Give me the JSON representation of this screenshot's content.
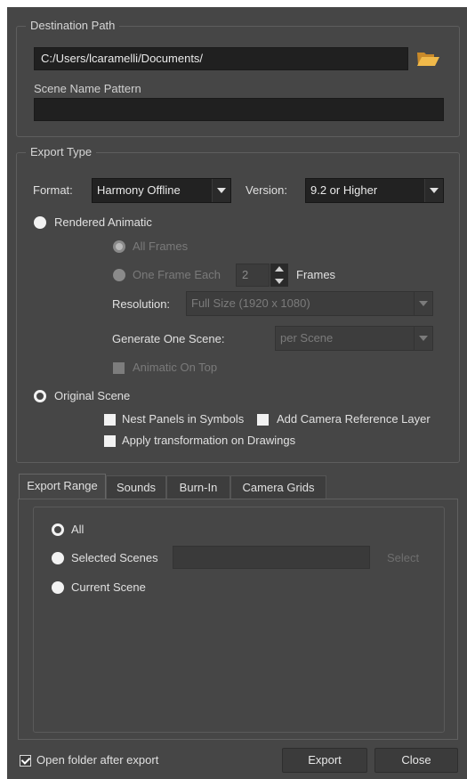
{
  "destination": {
    "legend": "Destination Path",
    "path_value": "C:/Users/lcaramelli/Documents/",
    "folder_icon": "folder-open-icon",
    "scene_pattern_label": "Scene Name Pattern",
    "scene_pattern_value": ""
  },
  "export_type": {
    "legend": "Export Type",
    "format_label": "Format:",
    "format_value": "Harmony Offline",
    "version_label": "Version:",
    "version_value": "9.2 or Higher",
    "rendered_animatic_label": "Rendered Animatic",
    "all_frames_label": "All Frames",
    "one_frame_each_label": "One Frame Each",
    "one_frame_each_value": "2",
    "frames_label": "Frames",
    "resolution_label": "Resolution:",
    "resolution_value": "Full Size (1920 x 1080)",
    "generate_label": "Generate One Scene:",
    "generate_value": "per Scene",
    "animatic_on_top_label": "Animatic On Top",
    "original_scene_label": "Original Scene",
    "nest_panels_label": "Nest Panels in Symbols",
    "add_camera_label": "Add Camera Reference Layer",
    "apply_transform_label": "Apply transformation on Drawings"
  },
  "tabs": [
    "Export Range",
    "Sounds",
    "Burn-In",
    "Camera Grids"
  ],
  "export_range": {
    "all_label": "All",
    "selected_scenes_label": "Selected Scenes",
    "selected_scenes_value": "",
    "select_button": "Select",
    "current_scene_label": "Current Scene"
  },
  "footer": {
    "open_folder_label": "Open folder after export",
    "export_button": "Export",
    "close_button": "Close"
  },
  "colors": {
    "background": "#464646",
    "field": "#202020",
    "folder_icon": "#f0b94a"
  }
}
